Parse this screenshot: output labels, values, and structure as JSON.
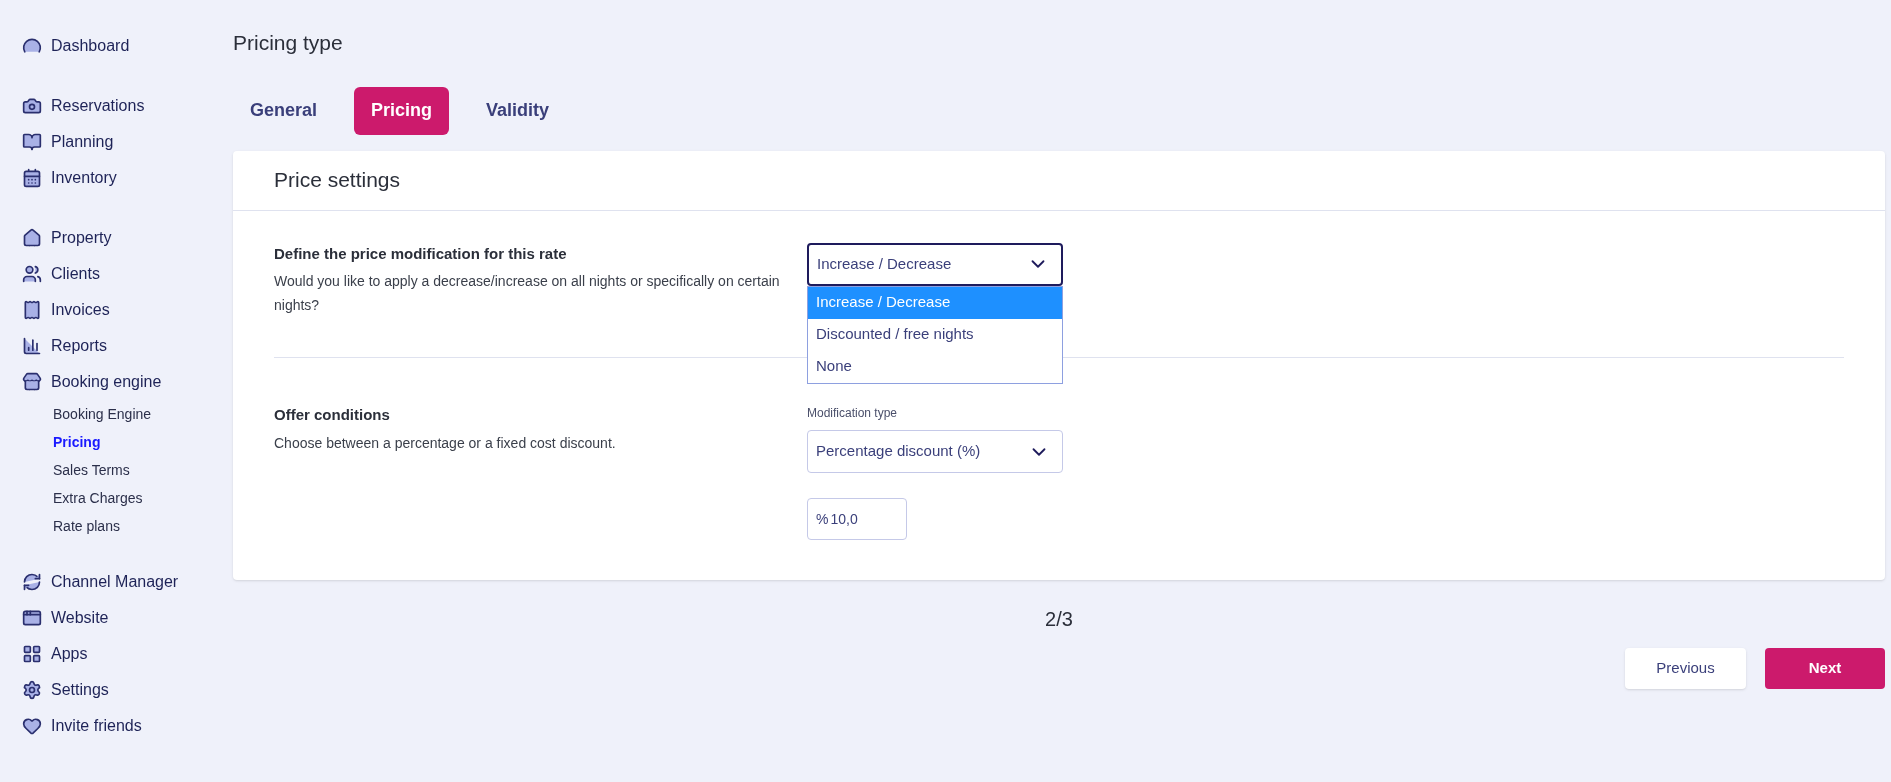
{
  "sidebar": {
    "groups": [
      {
        "items": [
          {
            "label": "Dashboard",
            "selected": false
          }
        ]
      },
      {
        "items": [
          {
            "label": "Reservations",
            "selected": false
          },
          {
            "label": "Planning",
            "selected": false
          },
          {
            "label": "Inventory",
            "selected": false
          }
        ]
      },
      {
        "items": [
          {
            "label": "Property",
            "selected": false
          },
          {
            "label": "Clients",
            "selected": false
          },
          {
            "label": "Invoices",
            "selected": false
          },
          {
            "label": "Reports",
            "selected": false
          },
          {
            "label": "Booking engine",
            "selected": false,
            "children": [
              {
                "label": "Booking Engine",
                "selected": false
              },
              {
                "label": "Pricing",
                "selected": true
              },
              {
                "label": "Sales Terms",
                "selected": false
              },
              {
                "label": "Extra Charges",
                "selected": false
              },
              {
                "label": "Rate plans",
                "selected": false
              }
            ]
          }
        ]
      },
      {
        "items": [
          {
            "label": "Channel Manager",
            "selected": false
          },
          {
            "label": "Website",
            "selected": false
          },
          {
            "label": "Apps",
            "selected": false
          },
          {
            "label": "Settings",
            "selected": false
          },
          {
            "label": "Invite friends",
            "selected": false
          }
        ]
      }
    ]
  },
  "page_title": "Pricing type",
  "tabs": [
    {
      "label": "General",
      "selected": false
    },
    {
      "label": "Pricing",
      "selected": true
    },
    {
      "label": "Validity",
      "selected": false
    }
  ],
  "card": {
    "title": "Price settings",
    "price_modification": {
      "title": "Define the price modification for this rate",
      "description": "Would you like to apply a decrease/increase on all nights or specifically on certain nights?",
      "select": {
        "value": "Increase / Decrease",
        "expanded": true,
        "options": [
          {
            "label": "Increase / Decrease",
            "selected": true
          },
          {
            "label": "Discounted / free nights",
            "selected": false
          },
          {
            "label": "None",
            "selected": false
          }
        ]
      }
    },
    "offer_conditions": {
      "title": "Offer conditions",
      "description": "Choose between a percentage or a fixed cost discount.",
      "modification_type": {
        "label": "Modification type",
        "value": "Percentage discount (%)",
        "expanded": false
      },
      "amount": {
        "prefix": "%",
        "value": "10,0"
      }
    }
  },
  "step": "2/3",
  "buttons": {
    "previous": "Previous",
    "next": "Next"
  }
}
